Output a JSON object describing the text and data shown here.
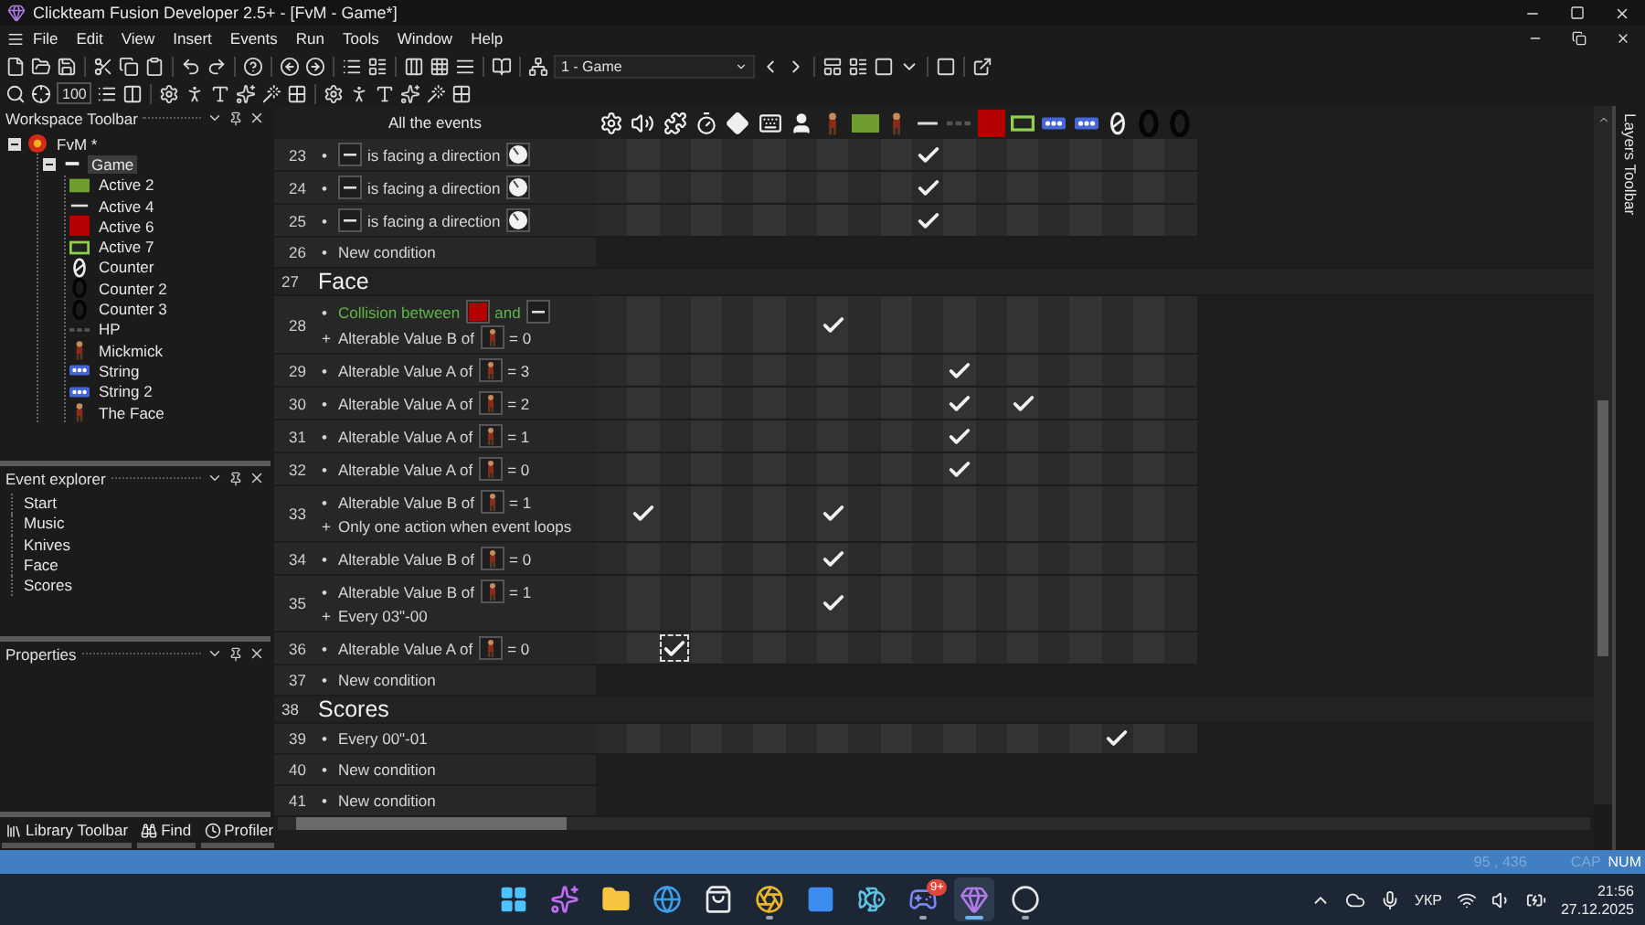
{
  "window": {
    "title": "Clickteam Fusion Developer 2.5+ - [FvM - Game*]"
  },
  "menu": [
    "File",
    "Edit",
    "View",
    "Insert",
    "Events",
    "Run",
    "Tools",
    "Window",
    "Help"
  ],
  "toolbar": {
    "zoom": "100",
    "frame_select": "1 - Game"
  },
  "workspace": {
    "title": "Workspace Toolbar",
    "tree": [
      {
        "label": "FvM *",
        "kind": "application",
        "expanded": true,
        "selected": false,
        "children": [
          {
            "label": "Game",
            "kind": "frame",
            "expanded": true,
            "selected": true,
            "children": [
              {
                "label": "Active 2",
                "kind": "green-rect",
                "selected": false
              },
              {
                "label": "Active 4",
                "kind": "line",
                "selected": false
              },
              {
                "label": "Active 6",
                "kind": "red-rect",
                "selected": false
              },
              {
                "label": "Active 7",
                "kind": "outline-rect",
                "selected": false
              },
              {
                "label": "Counter",
                "kind": "counter",
                "selected": false
              },
              {
                "label": "Counter 2",
                "kind": "counter-digit",
                "selected": false
              },
              {
                "label": "Counter 3",
                "kind": "counter-digit",
                "selected": false
              },
              {
                "label": "HP",
                "kind": "hp",
                "selected": false
              },
              {
                "label": "Mickmick",
                "kind": "figure",
                "selected": false
              },
              {
                "label": "String",
                "kind": "string",
                "selected": false
              },
              {
                "label": "String 2",
                "kind": "string",
                "selected": false
              },
              {
                "label": "The Face",
                "kind": "figure",
                "selected": false
              }
            ]
          }
        ]
      }
    ]
  },
  "event_explorer": {
    "title": "Event explorer",
    "items": [
      "Start",
      "Music",
      "Knives",
      "Face",
      "Scores"
    ]
  },
  "properties": {
    "title": "Properties"
  },
  "bottom_tabs": [
    {
      "label": "Library Toolbar",
      "kind": "library"
    },
    {
      "label": "Find",
      "kind": "find"
    },
    {
      "label": "Profiler",
      "kind": "profiler"
    }
  ],
  "event_editor": {
    "heading": "All the events",
    "columns": [
      {
        "kind": "special"
      },
      {
        "kind": "sound"
      },
      {
        "kind": "storyboard"
      },
      {
        "kind": "timer"
      },
      {
        "kind": "create"
      },
      {
        "kind": "keyboard"
      },
      {
        "kind": "player"
      },
      {
        "kind": "figure"
      },
      {
        "kind": "green-rect"
      },
      {
        "kind": "figure"
      },
      {
        "kind": "line"
      },
      {
        "kind": "hp"
      },
      {
        "kind": "red-rect"
      },
      {
        "kind": "outline-rect"
      },
      {
        "kind": "string"
      },
      {
        "kind": "string"
      },
      {
        "kind": "counter"
      },
      {
        "kind": "counter-digit"
      },
      {
        "kind": "counter-digit"
      }
    ],
    "rows": [
      {
        "kind": "event",
        "number": "23",
        "focused": false,
        "conditions": [
          {
            "marker": "•",
            "highlight": false,
            "parts": [
              {
                "kind": "line"
              },
              {
                "kind": "text",
                "text": "is facing a direction"
              },
              {
                "kind": "dial"
              }
            ]
          }
        ],
        "cells": [
          false,
          false,
          false,
          false,
          false,
          false,
          false,
          false,
          false,
          false,
          true,
          false,
          false,
          false,
          false,
          false,
          false,
          false,
          false
        ]
      },
      {
        "kind": "event",
        "number": "24",
        "focused": false,
        "conditions": [
          {
            "marker": "•",
            "highlight": false,
            "parts": [
              {
                "kind": "line"
              },
              {
                "kind": "text",
                "text": "is facing a direction"
              },
              {
                "kind": "dial"
              }
            ]
          }
        ],
        "cells": [
          false,
          false,
          false,
          false,
          false,
          false,
          false,
          false,
          false,
          false,
          true,
          false,
          false,
          false,
          false,
          false,
          false,
          false,
          false
        ]
      },
      {
        "kind": "event",
        "number": "25",
        "focused": false,
        "conditions": [
          {
            "marker": "•",
            "highlight": false,
            "parts": [
              {
                "kind": "line"
              },
              {
                "kind": "text",
                "text": "is facing a direction"
              },
              {
                "kind": "dial"
              }
            ]
          }
        ],
        "cells": [
          false,
          false,
          false,
          false,
          false,
          false,
          false,
          false,
          false,
          false,
          true,
          false,
          false,
          false,
          false,
          false,
          false,
          false,
          false
        ]
      },
      {
        "kind": "new",
        "number": "26",
        "marker": "•",
        "text": "New condition"
      },
      {
        "kind": "group",
        "number": "27",
        "title": "Face"
      },
      {
        "kind": "event",
        "number": "28",
        "focused": false,
        "conditions": [
          {
            "marker": "•",
            "highlight": true,
            "parts": [
              {
                "kind": "text",
                "text": "Collision between"
              },
              {
                "kind": "red-rect"
              },
              {
                "kind": "text",
                "text": "and"
              },
              {
                "kind": "line"
              }
            ]
          },
          {
            "marker": "+",
            "highlight": false,
            "parts": [
              {
                "kind": "text",
                "text": "Alterable Value B of"
              },
              {
                "kind": "figure"
              },
              {
                "kind": "text",
                "text": "= 0"
              }
            ]
          }
        ],
        "cells": [
          false,
          false,
          false,
          false,
          false,
          false,
          false,
          true,
          false,
          false,
          false,
          false,
          false,
          false,
          false,
          false,
          false,
          false,
          false
        ]
      },
      {
        "kind": "event",
        "number": "29",
        "focused": false,
        "conditions": [
          {
            "marker": "•",
            "highlight": false,
            "parts": [
              {
                "kind": "text",
                "text": "Alterable Value A of"
              },
              {
                "kind": "figure"
              },
              {
                "kind": "text",
                "text": "= 3"
              }
            ]
          }
        ],
        "cells": [
          false,
          false,
          false,
          false,
          false,
          false,
          false,
          false,
          false,
          false,
          false,
          true,
          false,
          false,
          false,
          false,
          false,
          false,
          false
        ]
      },
      {
        "kind": "event",
        "number": "30",
        "focused": false,
        "conditions": [
          {
            "marker": "•",
            "highlight": false,
            "parts": [
              {
                "kind": "text",
                "text": "Alterable Value A of"
              },
              {
                "kind": "figure"
              },
              {
                "kind": "text",
                "text": "= 2"
              }
            ]
          }
        ],
        "cells": [
          false,
          false,
          false,
          false,
          false,
          false,
          false,
          false,
          false,
          false,
          false,
          true,
          false,
          true,
          false,
          false,
          false,
          false,
          false
        ]
      },
      {
        "kind": "event",
        "number": "31",
        "focused": false,
        "conditions": [
          {
            "marker": "•",
            "highlight": false,
            "parts": [
              {
                "kind": "text",
                "text": "Alterable Value A of"
              },
              {
                "kind": "figure"
              },
              {
                "kind": "text",
                "text": "= 1"
              }
            ]
          }
        ],
        "cells": [
          false,
          false,
          false,
          false,
          false,
          false,
          false,
          false,
          false,
          false,
          false,
          true,
          false,
          false,
          false,
          false,
          false,
          false,
          false
        ]
      },
      {
        "kind": "event",
        "number": "32",
        "focused": false,
        "conditions": [
          {
            "marker": "•",
            "highlight": false,
            "parts": [
              {
                "kind": "text",
                "text": "Alterable Value A of"
              },
              {
                "kind": "figure"
              },
              {
                "kind": "text",
                "text": "= 0"
              }
            ]
          }
        ],
        "cells": [
          false,
          false,
          false,
          false,
          false,
          false,
          false,
          false,
          false,
          false,
          false,
          true,
          false,
          false,
          false,
          false,
          false,
          false,
          false
        ]
      },
      {
        "kind": "event",
        "number": "33",
        "focused": false,
        "conditions": [
          {
            "marker": "•",
            "highlight": false,
            "parts": [
              {
                "kind": "text",
                "text": "Alterable Value B of"
              },
              {
                "kind": "figure"
              },
              {
                "kind": "text",
                "text": "= 1"
              }
            ]
          },
          {
            "marker": "+",
            "highlight": false,
            "parts": [
              {
                "kind": "text",
                "text": "Only one action when event loops"
              }
            ]
          }
        ],
        "cells": [
          false,
          true,
          false,
          false,
          false,
          false,
          false,
          true,
          false,
          false,
          false,
          false,
          false,
          false,
          false,
          false,
          false,
          false,
          false
        ]
      },
      {
        "kind": "event",
        "number": "34",
        "focused": false,
        "conditions": [
          {
            "marker": "•",
            "highlight": false,
            "parts": [
              {
                "kind": "text",
                "text": "Alterable Value B of"
              },
              {
                "kind": "figure"
              },
              {
                "kind": "text",
                "text": "= 0"
              }
            ]
          }
        ],
        "cells": [
          false,
          false,
          false,
          false,
          false,
          false,
          false,
          true,
          false,
          false,
          false,
          false,
          false,
          false,
          false,
          false,
          false,
          false,
          false
        ]
      },
      {
        "kind": "event",
        "number": "35",
        "focused": false,
        "conditions": [
          {
            "marker": "•",
            "highlight": false,
            "parts": [
              {
                "kind": "text",
                "text": "Alterable Value B of"
              },
              {
                "kind": "figure"
              },
              {
                "kind": "text",
                "text": "= 1"
              }
            ]
          },
          {
            "marker": "+",
            "highlight": false,
            "parts": [
              {
                "kind": "text",
                "text": "Every 03\"-00"
              }
            ]
          }
        ],
        "cells": [
          false,
          false,
          false,
          false,
          false,
          false,
          false,
          true,
          false,
          false,
          false,
          false,
          false,
          false,
          false,
          false,
          false,
          false,
          false
        ]
      },
      {
        "kind": "event",
        "number": "36",
        "focused": true,
        "conditions": [
          {
            "marker": "•",
            "highlight": false,
            "parts": [
              {
                "kind": "text",
                "text": "Alterable Value A of"
              },
              {
                "kind": "figure"
              },
              {
                "kind": "text",
                "text": "= 0"
              }
            ]
          }
        ],
        "cells": [
          false,
          false,
          true,
          false,
          false,
          false,
          false,
          false,
          false,
          false,
          false,
          false,
          false,
          false,
          false,
          false,
          false,
          false,
          false
        ]
      },
      {
        "kind": "new",
        "number": "37",
        "marker": "•",
        "text": "New condition"
      },
      {
        "kind": "group",
        "number": "38",
        "title": "Scores"
      },
      {
        "kind": "event",
        "number": "39",
        "focused": false,
        "conditions": [
          {
            "marker": "•",
            "highlight": false,
            "parts": [
              {
                "kind": "text",
                "text": "Every 00\"-01"
              }
            ]
          }
        ],
        "cells": [
          false,
          false,
          false,
          false,
          false,
          false,
          false,
          false,
          false,
          false,
          false,
          false,
          false,
          false,
          false,
          false,
          true,
          false,
          false
        ]
      },
      {
        "kind": "new",
        "number": "40",
        "marker": "•",
        "text": "New condition"
      },
      {
        "kind": "new",
        "number": "41",
        "marker": "•",
        "text": "New condition"
      }
    ]
  },
  "layers_toolbar": {
    "title": "Layers Toolbar"
  },
  "status_bar": {
    "coords": "95 , 436",
    "keys": [
      {
        "label": "CAP",
        "on": false
      },
      {
        "label": "NUM",
        "on": true
      }
    ]
  },
  "taskbar": {
    "apps": [
      {
        "kind": "start",
        "running": false,
        "active": false
      },
      {
        "kind": "copilot",
        "running": false,
        "active": false
      },
      {
        "kind": "folder",
        "running": false,
        "active": false
      },
      {
        "kind": "browser",
        "running": false,
        "active": false
      },
      {
        "kind": "store",
        "running": false,
        "active": false
      },
      {
        "kind": "chrome",
        "running": true,
        "active": false
      },
      {
        "kind": "square",
        "running": false,
        "active": false
      },
      {
        "kind": "fish",
        "running": false,
        "active": false
      },
      {
        "kind": "chat",
        "running": true,
        "active": false,
        "badge": "9+"
      },
      {
        "kind": "fusion",
        "running": true,
        "active": true
      },
      {
        "kind": "recorder",
        "running": true,
        "active": false
      }
    ],
    "language": "УКР",
    "time": "21:56",
    "date": "27.12.2025"
  }
}
